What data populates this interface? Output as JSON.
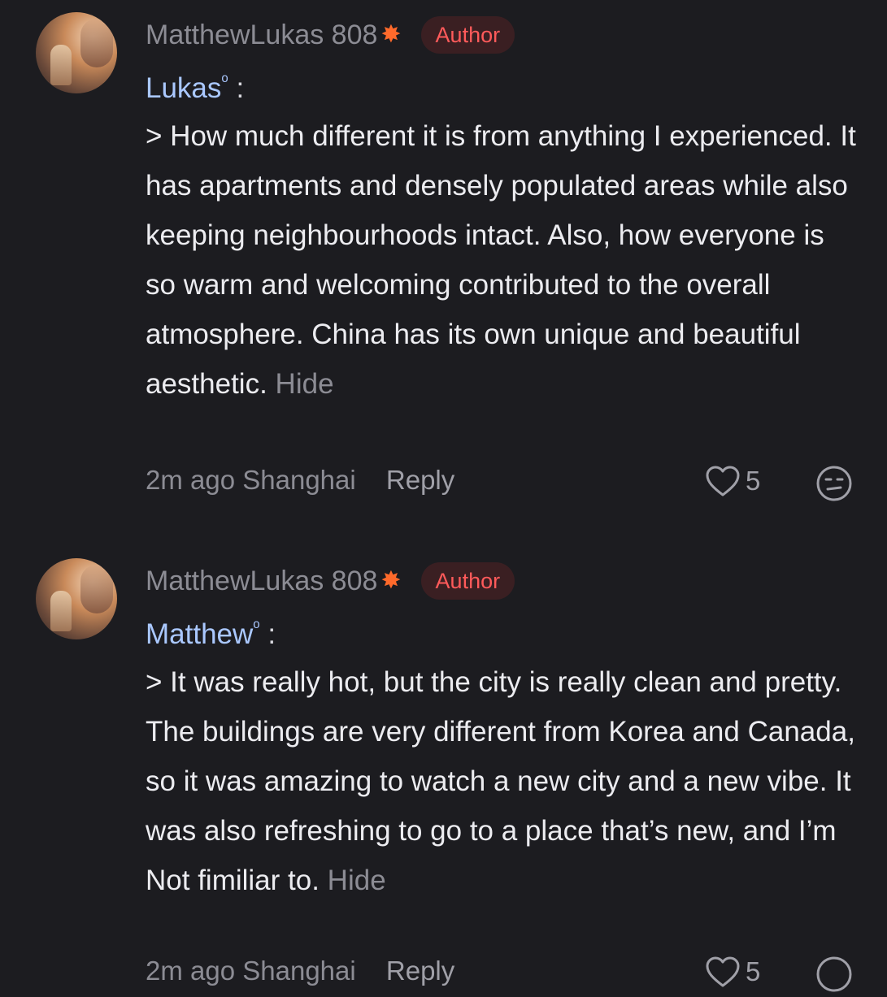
{
  "comments": [
    {
      "username": "MatthewLukas 808",
      "badge": "Author",
      "mention": "Lukas",
      "mention_suffix": " :",
      "body": "> How much different it is from anything I experienced. It has apartments and densely populated areas while also keeping neighbourhoods intact. Also, how everyone is so warm and welcoming contributed to the overall atmosphere. China has its own unique and beautiful aesthetic.",
      "hide_label": "Hide",
      "time": "2m ago",
      "location": "Shanghai",
      "reply_label": "Reply",
      "likes": "5"
    },
    {
      "username": "MatthewLukas 808",
      "badge": "Author",
      "mention": "Matthew",
      "mention_suffix": " :",
      "body": "> It was really hot, but the city is really clean and pretty. The buildings are very different from Korea and Canada, so it was amazing to watch a new city and a new vibe. It was also refreshing to go to a place that’s new, and I’m Not fimiliar to.",
      "hide_label": "Hide",
      "time": "2m ago",
      "location": "Shanghai",
      "reply_label": "Reply",
      "likes": "5"
    }
  ],
  "icons": {
    "burst": "collision-emoji",
    "mention": "search-icon",
    "like": "heart-outline-icon",
    "reaction": "smiley-face-icon"
  },
  "colors": {
    "background": "#1c1c20",
    "badge_text": "#ff5a5a",
    "badge_bg": "#3a1f22",
    "mention": "#aac8ff",
    "muted": "#8c8c94"
  }
}
